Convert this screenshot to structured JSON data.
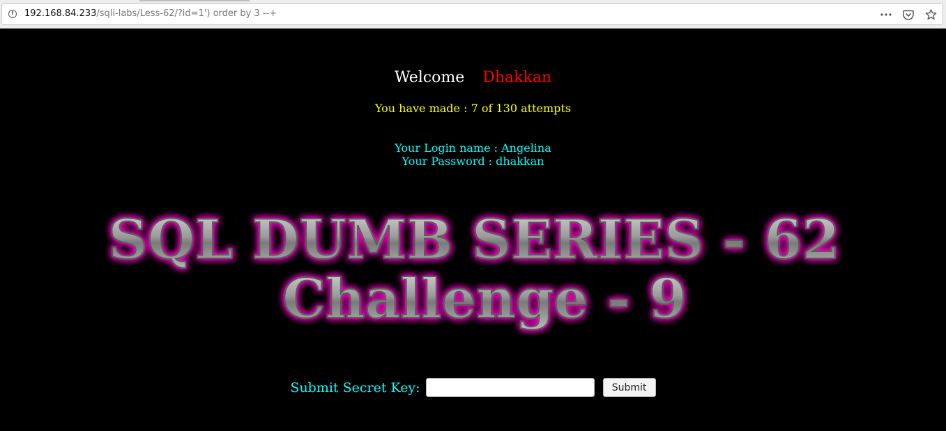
{
  "browser": {
    "url_host": "192.168.84.233",
    "url_path": "/sqli-labs/Less-62/?id=1') order by 3 --+",
    "icons": [
      "info-icon",
      "more-icon",
      "pocket-icon",
      "bookmark-star-icon"
    ]
  },
  "page": {
    "welcome": "Welcome",
    "username": "Dhakkan",
    "attempts": "You have made : 7 of 130 attempts",
    "login_name": "Your Login name : Angelina",
    "password": "Your Password : dhakkan",
    "banner_line1": "SQL DUMB SERIES - 62",
    "banner_line2": "Challenge - 9",
    "secret_label": "Submit Secret Key:",
    "secret_value": "",
    "submit_label": "Submit"
  },
  "colors": {
    "background": "#000000",
    "welcome": "#ffffff",
    "username": "#ff0000",
    "attempts": "#ffff00",
    "credentials": "#00ffff",
    "banner_glow": "#ff00cc"
  }
}
